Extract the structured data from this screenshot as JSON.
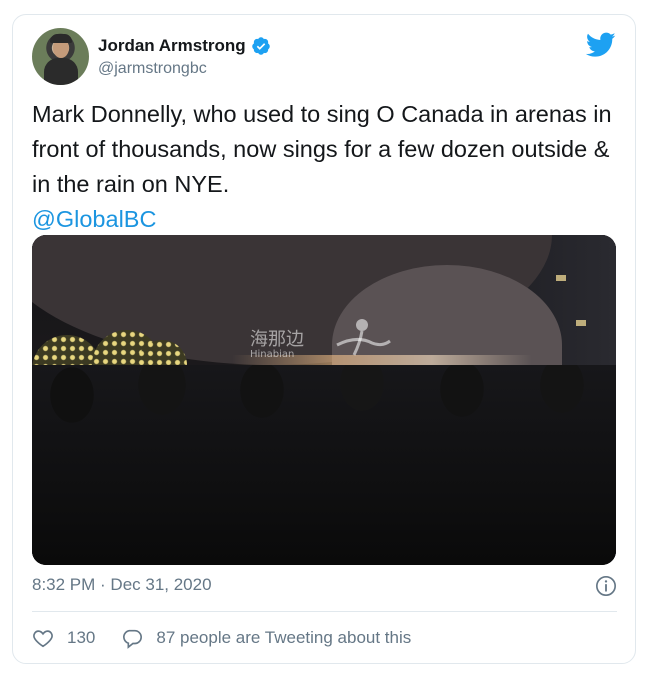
{
  "author": {
    "display_name": "Jordan Armstrong",
    "handle": "@jarmstrongbc",
    "verified": true
  },
  "tweet": {
    "text": "Mark Donnelly, who used to sing O Canada in arenas in front of thousands, now sings for a few dozen outside & in the rain on NYE.",
    "mention": "@GlobalBC"
  },
  "media": {
    "watermark": "海那边",
    "watermark_sub": "Hinabian"
  },
  "meta": {
    "timestamp": "8:32 PM · Dec 31, 2020"
  },
  "actions": {
    "like_count": "130",
    "reply_text": "87 people are Tweeting about this"
  },
  "colors": {
    "twitter_blue": "#1da1f2",
    "mention_blue": "#1b95e0",
    "secondary_text": "#657786",
    "border": "#e1e8ed"
  },
  "icons": [
    "twitter-bird-icon",
    "verified-badge-icon",
    "info-icon",
    "heart-icon",
    "reply-bubble-icon"
  ]
}
